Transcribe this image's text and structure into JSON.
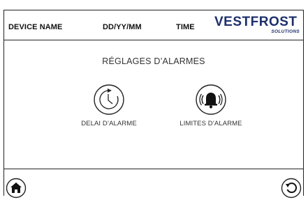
{
  "header": {
    "device_name": "DEVICE NAME",
    "date_format": "DD/YY/MM",
    "time": "TIME",
    "logo_text": "VESTFROST",
    "logo_subtext": "SOLUTIONS"
  },
  "main": {
    "title": "RÉGLAGES D’ALARMES",
    "tiles": [
      {
        "label": "DELAI D’ALARME",
        "icon": "clock-timer-icon"
      },
      {
        "label": "LIMITES D’ALARME",
        "icon": "alarm-bell-icon"
      }
    ]
  },
  "footer": {
    "home_icon": "home-icon",
    "back_icon": "back-icon"
  },
  "colors": {
    "brand": "#1d2f6b",
    "line": "#222222"
  }
}
